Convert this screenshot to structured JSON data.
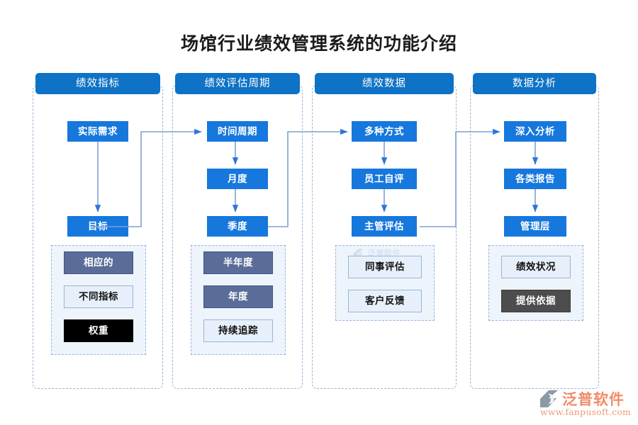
{
  "page_title": "场馆行业绩效管理系统的功能介绍",
  "theme": {
    "header_blue": "#0E72C6",
    "box_blue": "#1677DD",
    "slate": "#5A6D99",
    "light_blue": "#E7F0FA",
    "black": "#000000",
    "dark_gray": "#4D4D4D",
    "dashed_border": "#9BB4D6",
    "connector": "#7E9FD4"
  },
  "columns": [
    {
      "id": "performance-indicators",
      "header": "绩效指标",
      "flow": [
        "实际需求",
        "目标"
      ],
      "subgroup": [
        {
          "label": "相应的",
          "style": "slate"
        },
        {
          "label": "不同指标",
          "style": "light"
        },
        {
          "label": "权重",
          "style": "black"
        }
      ]
    },
    {
      "id": "evaluation-cycle",
      "header": "绩效评估周期",
      "flow": [
        "时间周期",
        "月度",
        "季度"
      ],
      "subgroup": [
        {
          "label": "半年度",
          "style": "slate"
        },
        {
          "label": "年度",
          "style": "slate"
        },
        {
          "label": "持续追踪",
          "style": "light"
        }
      ]
    },
    {
      "id": "performance-data",
      "header": "绩效数据",
      "flow": [
        "多种方式",
        "员工自评",
        "主管评估"
      ],
      "subgroup": [
        {
          "label": "同事评估",
          "style": "light"
        },
        {
          "label": "客户反馈",
          "style": "light"
        }
      ]
    },
    {
      "id": "data-analysis",
      "header": "数据分析",
      "flow": [
        "深入分析",
        "各类报告",
        "管理层"
      ],
      "subgroup": [
        {
          "label": "绩效状况",
          "style": "light"
        },
        {
          "label": "提供依据",
          "style": "gray"
        }
      ]
    }
  ],
  "watermark": {
    "text": "泛普软件"
  },
  "logo": {
    "name": "泛普软件",
    "url": "www.fanpusoft.com"
  }
}
